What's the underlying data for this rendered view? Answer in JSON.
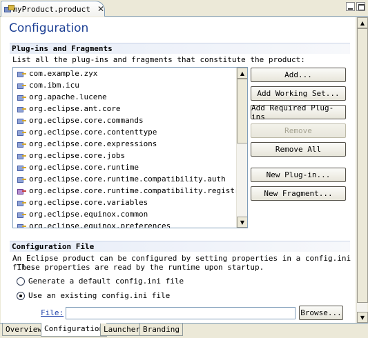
{
  "editor_tab": {
    "title": "myProduct.product"
  },
  "page": {
    "title": "Configuration"
  },
  "plugins_section": {
    "header": "Plug-ins and Fragments",
    "description": "List all the plug-ins and fragments that constitute the product:",
    "items": [
      {
        "label": "com.example.zyx",
        "icon": "plugin-icon"
      },
      {
        "label": "com.ibm.icu",
        "icon": "plugin-icon"
      },
      {
        "label": "org.apache.lucene",
        "icon": "plugin-icon"
      },
      {
        "label": "org.eclipse.ant.core",
        "icon": "plugin-icon"
      },
      {
        "label": "org.eclipse.core.commands",
        "icon": "plugin-icon"
      },
      {
        "label": "org.eclipse.core.contenttype",
        "icon": "plugin-icon"
      },
      {
        "label": "org.eclipse.core.expressions",
        "icon": "plugin-icon"
      },
      {
        "label": "org.eclipse.core.jobs",
        "icon": "plugin-icon"
      },
      {
        "label": "org.eclipse.core.runtime",
        "icon": "plugin-icon"
      },
      {
        "label": "org.eclipse.core.runtime.compatibility.auth",
        "icon": "plugin-icon"
      },
      {
        "label": "org.eclipse.core.runtime.compatibility.registry",
        "icon": "fragment-icon"
      },
      {
        "label": "org.eclipse.core.variables",
        "icon": "plugin-icon"
      },
      {
        "label": "org.eclipse.equinox.common",
        "icon": "plugin-icon"
      },
      {
        "label": "org.eclipse.equinox.preferences",
        "icon": "plugin-icon"
      }
    ],
    "buttons": {
      "add": "Add...",
      "add_working_set": "Add Working Set...",
      "add_required": "Add Required Plug-ins",
      "remove": "Remove",
      "remove_all": "Remove All",
      "new_plugin": "New Plug-in...",
      "new_fragment": "New Fragment..."
    }
  },
  "config_section": {
    "header": "Configuration File",
    "description_line1": "An Eclipse product can be configured by setting properties in a config.ini file.",
    "description_line2": " These properties are read by the runtime upon startup.",
    "radio_generate": "Generate a default config.ini file",
    "radio_existing": "Use an existing config.ini file",
    "selected_option": "existing",
    "file_label": "File:",
    "file_value": "",
    "browse": "Browse..."
  },
  "page_tabs": [
    {
      "label": "Overview",
      "active": false
    },
    {
      "label": "Configuration",
      "active": true
    },
    {
      "label": "Launcher",
      "active": false
    },
    {
      "label": "Branding",
      "active": false
    }
  ]
}
